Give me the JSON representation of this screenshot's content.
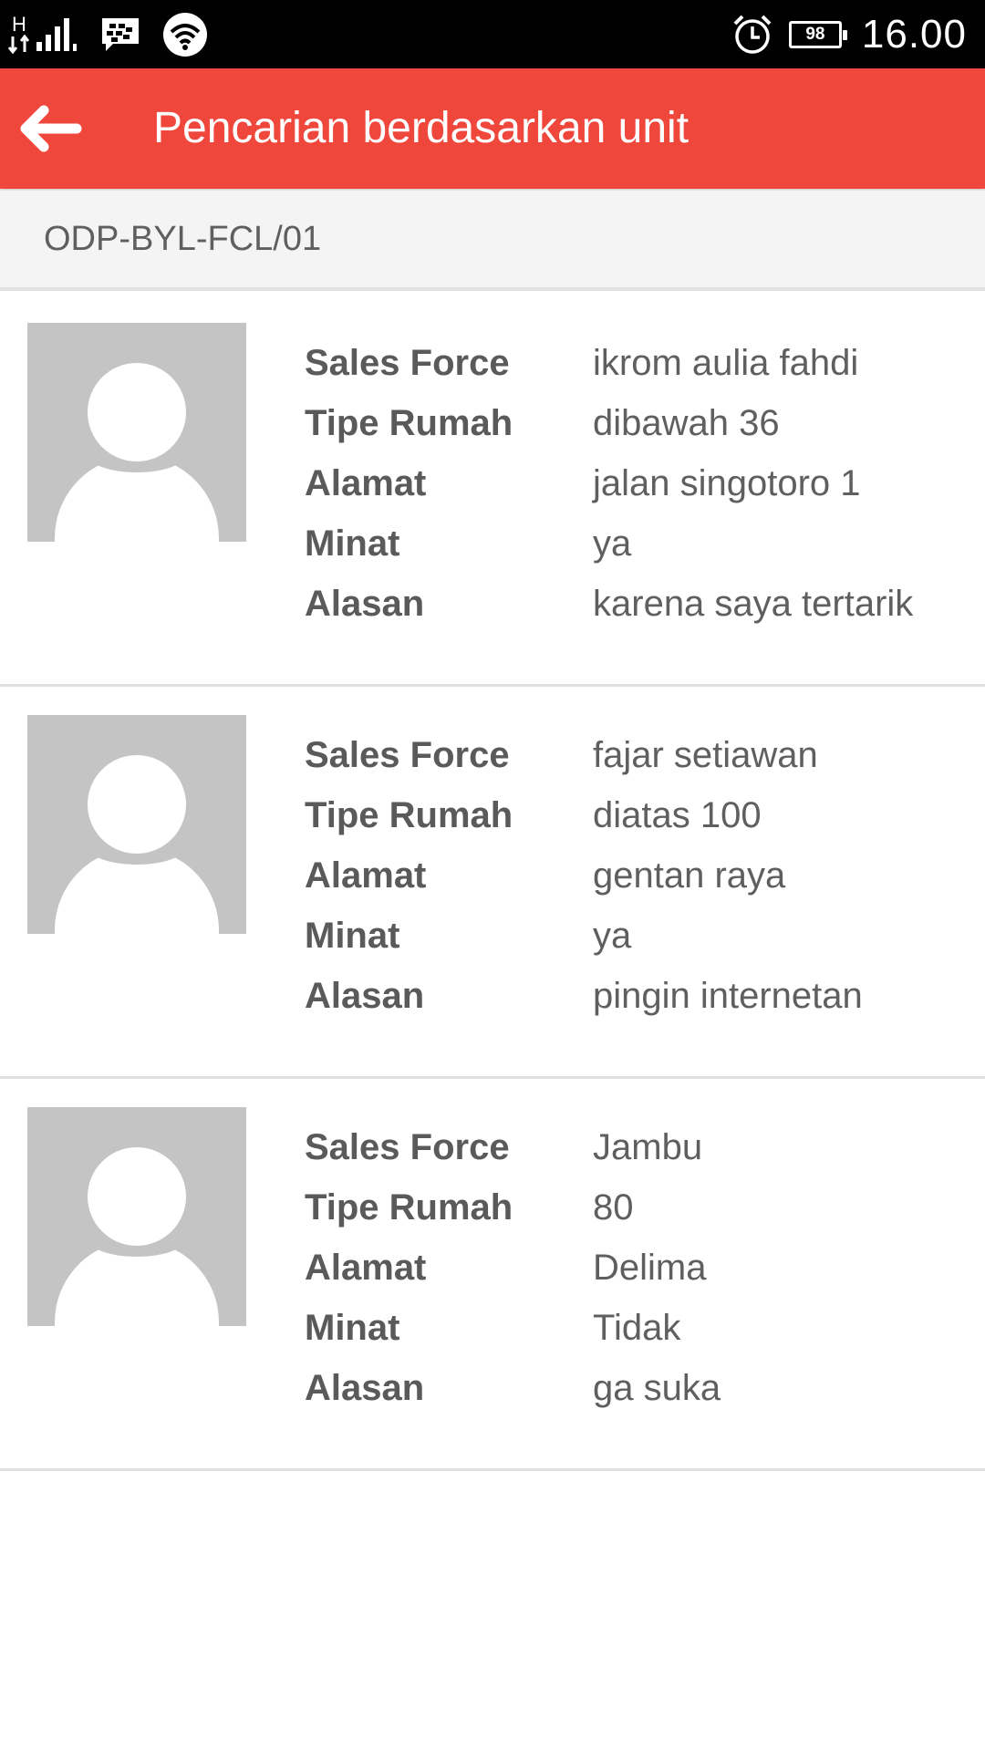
{
  "status_bar": {
    "network_type": "H",
    "battery_level": "98",
    "time": "16.00",
    "icons": [
      "signal-icon",
      "bbm-icon",
      "wifi-icon",
      "alarm-icon",
      "battery-icon"
    ]
  },
  "app_bar": {
    "title": "Pencarian berdasarkan unit",
    "back_icon": "arrow-left-icon",
    "color": "#f0473c"
  },
  "unit": {
    "code": "ODP-BYL-FCL/01"
  },
  "labels": {
    "sales_force": "Sales Force",
    "tipe_rumah": "Tipe Rumah",
    "alamat": "Alamat",
    "minat": "Minat",
    "alasan": "Alasan"
  },
  "items": [
    {
      "sales_force": "ikrom aulia fahdi",
      "tipe_rumah": "dibawah 36",
      "alamat": "jalan singotoro 1",
      "minat": "ya",
      "alasan": "karena saya tertarik"
    },
    {
      "sales_force": "fajar setiawan",
      "tipe_rumah": "diatas 100",
      "alamat": "gentan raya",
      "minat": "ya",
      "alasan": "pingin internetan"
    },
    {
      "sales_force": "Jambu",
      "tipe_rumah": "80",
      "alamat": "Delima",
      "minat": "Tidak",
      "alasan": "ga suka"
    }
  ]
}
